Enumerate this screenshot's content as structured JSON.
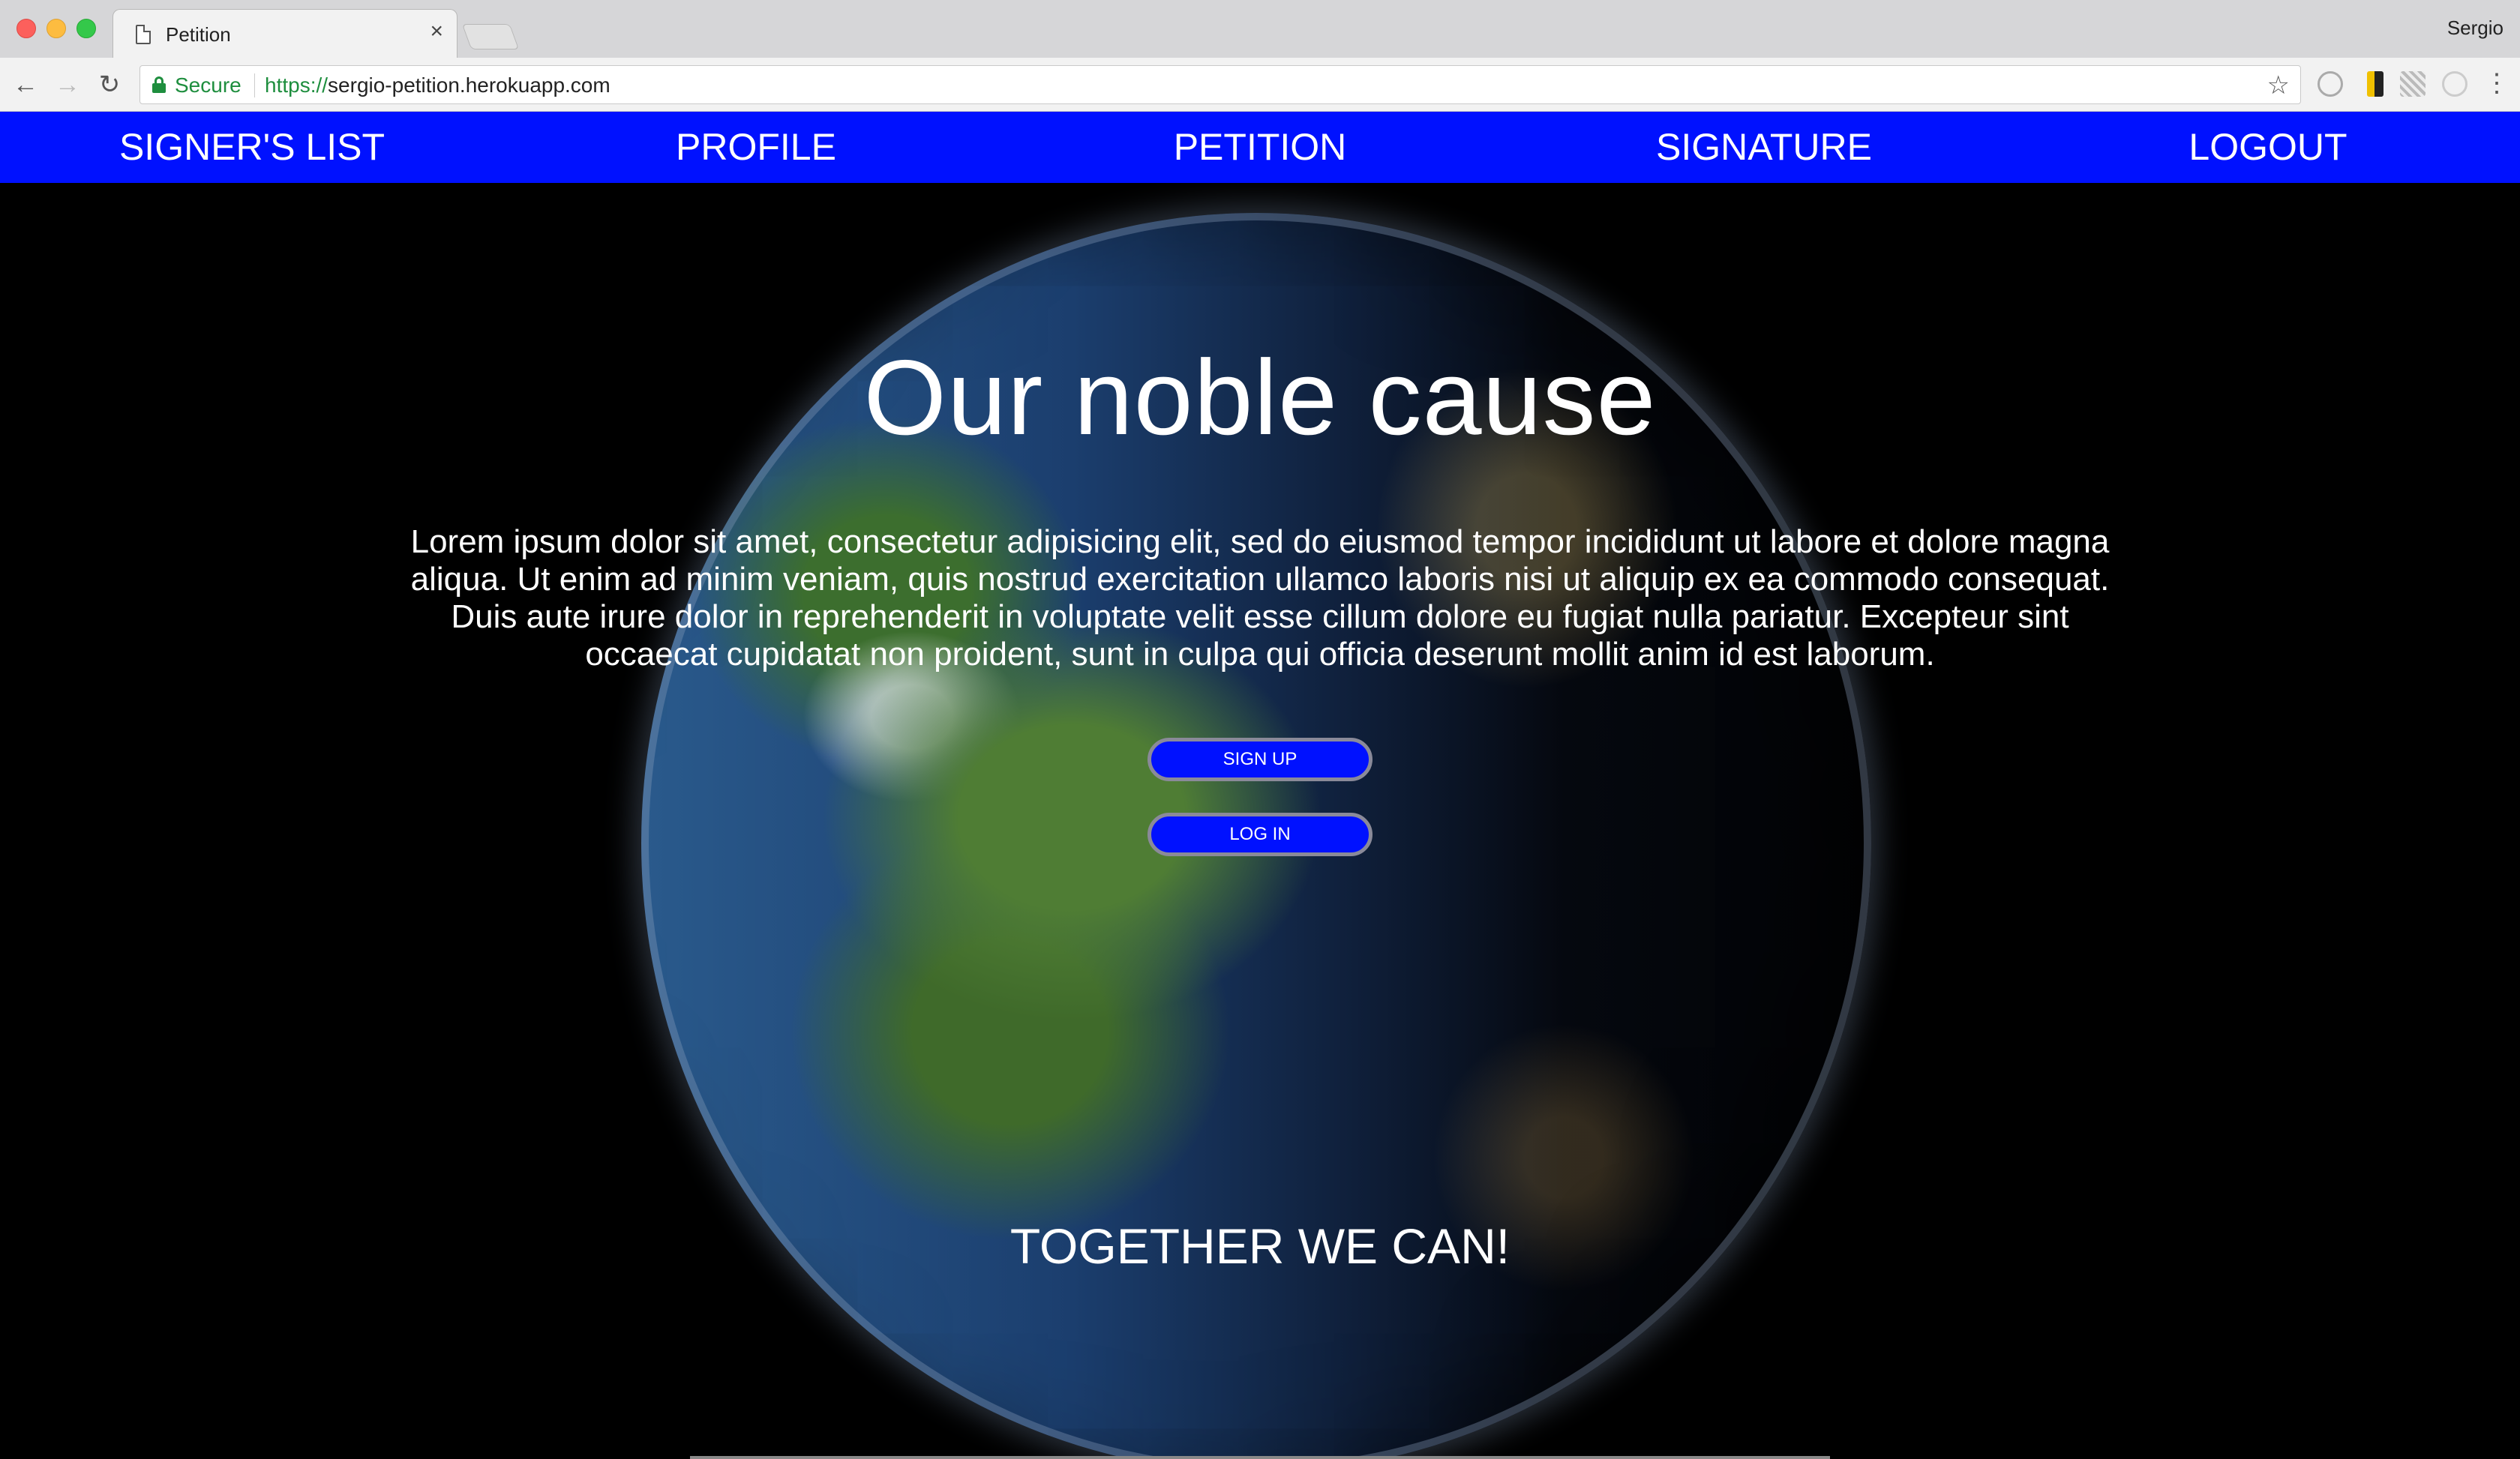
{
  "browser": {
    "tab_title": "Petition",
    "tab_close": "×",
    "profile_name": "Sergio",
    "secure_label": "Secure",
    "url_scheme": "https://",
    "url_host": "sergio-petition.herokuapp.com"
  },
  "nav": {
    "items": [
      {
        "label": "SIGNER'S LIST"
      },
      {
        "label": "PROFILE"
      },
      {
        "label": "PETITION"
      },
      {
        "label": "SIGNATURE"
      },
      {
        "label": "LOGOUT"
      }
    ],
    "color": "#0011ff"
  },
  "hero": {
    "headline": "Our noble cause",
    "body": "Lorem ipsum dolor sit amet, consectetur adipisicing elit, sed do eiusmod tempor incididunt ut labore et dolore magna aliqua. Ut enim ad minim veniam, quis nostrud exercitation ullamco laboris nisi ut aliquip ex ea commodo consequat. Duis aute irure dolor in reprehenderit in voluptate velit esse cillum dolore eu fugiat nulla pariatur. Excepteur sint occaecat cupidatat non proident, sunt in culpa qui officia deserunt mollit anim id est laborum.",
    "signup_label": "SIGN UP",
    "login_label": "LOG IN",
    "tagline": "TOGETHER WE CAN!"
  }
}
